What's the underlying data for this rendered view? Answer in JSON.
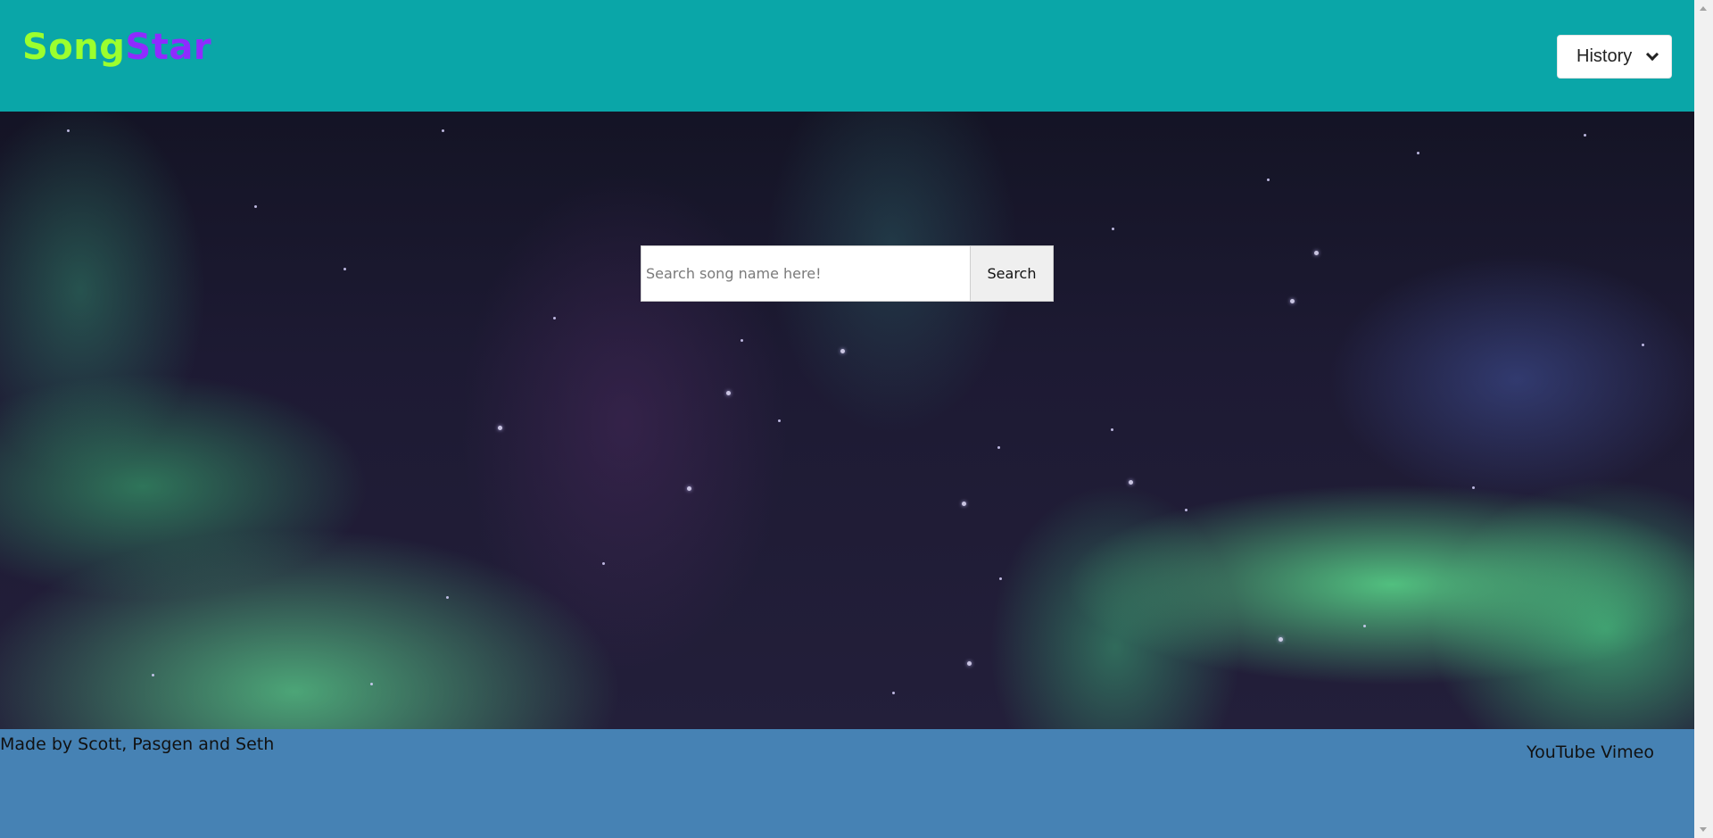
{
  "header": {
    "brand_part1": "Song",
    "brand_part2": "Star",
    "history_label": "History",
    "colors": {
      "bar": "#0aa6a8",
      "song": "#9cff2e",
      "star": "#8f2bff"
    }
  },
  "search": {
    "placeholder": "Search song name here!",
    "value": "",
    "button_label": "Search"
  },
  "footer": {
    "credits": "Made by Scott, Pasgen and Seth",
    "links": [
      "YouTube",
      "Vimeo"
    ],
    "color": "#4682b4"
  },
  "icons": {
    "history_chevron": "chevron-down-icon"
  }
}
